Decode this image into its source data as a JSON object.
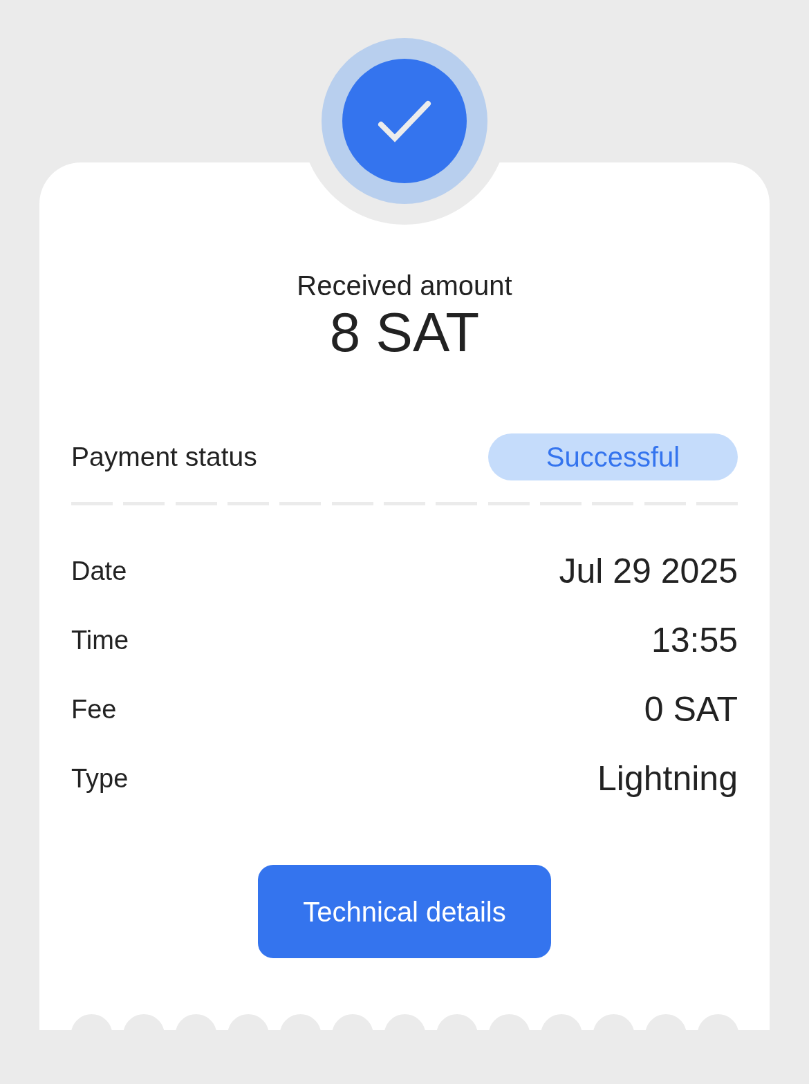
{
  "summary": {
    "label": "Received amount",
    "amount": "8 SAT"
  },
  "status_row": {
    "label": "Payment status",
    "badge": "Successful"
  },
  "details": [
    {
      "label": "Date",
      "value": "Jul 29 2025"
    },
    {
      "label": "Time",
      "value": "13:55"
    },
    {
      "label": "Fee",
      "value": "0 SAT"
    },
    {
      "label": "Type",
      "value": "Lightning"
    }
  ],
  "button": {
    "label": "Technical details"
  }
}
